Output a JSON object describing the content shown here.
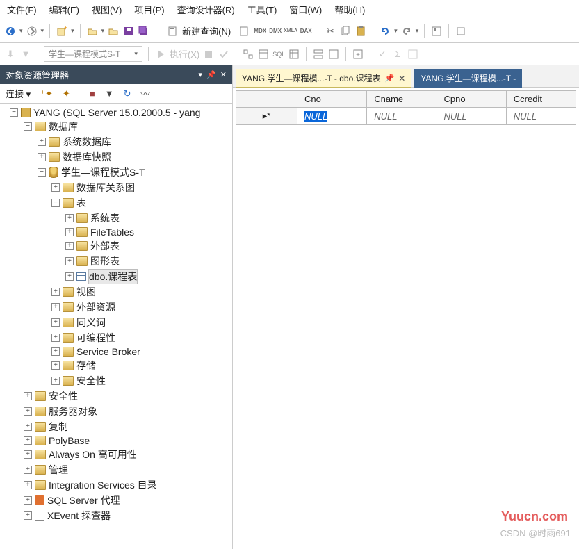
{
  "menu": [
    "文件(F)",
    "编辑(E)",
    "视图(V)",
    "项目(P)",
    "查询设计器(R)",
    "工具(T)",
    "窗口(W)",
    "帮助(H)"
  ],
  "toolbar": {
    "new_query": "新建查询(N)"
  },
  "dropdown": {
    "value": "学生—课程模式S-T"
  },
  "toolbar2": {
    "execute": "执行(X)"
  },
  "panel": {
    "title": "对象资源管理器",
    "connect": "连接"
  },
  "tree": {
    "root": "YANG (SQL Server 15.0.2000.5 - yang",
    "databases": "数据库",
    "sys_db": "系统数据库",
    "db_snap": "数据库快照",
    "student_db": "学生—课程模式S-T",
    "rel_diag": "数据库关系图",
    "tables": "表",
    "sys_tables": "系统表",
    "file_tables": "FileTables",
    "ext_tables": "外部表",
    "graph_tables": "图形表",
    "course_table": "dbo.课程表",
    "views": "视图",
    "ext_res": "外部资源",
    "synonyms": "同义词",
    "programmability": "可编程性",
    "service_broker": "Service Broker",
    "storage": "存储",
    "security_inner": "安全性",
    "security": "安全性",
    "server_obj": "服务器对象",
    "replication": "复制",
    "polybase": "PolyBase",
    "always_on": "Always On 高可用性",
    "management": "管理",
    "int_svc": "Integration Services 目录",
    "sql_agent": "SQL Server 代理",
    "xevent": "XEvent 探查器"
  },
  "tabs": {
    "active": "YANG.学生—课程模...-T - dbo.课程表",
    "inactive": "YANG.学生—课程模...-T -"
  },
  "grid": {
    "cols": [
      "Cno",
      "Cname",
      "Cpno",
      "Ccredit"
    ],
    "rowmark": "▸*",
    "nulls": [
      "NULL",
      "NULL",
      "NULL",
      "NULL"
    ]
  },
  "watermark": "Yuucn.com",
  "csdn": "CSDN @时雨691"
}
